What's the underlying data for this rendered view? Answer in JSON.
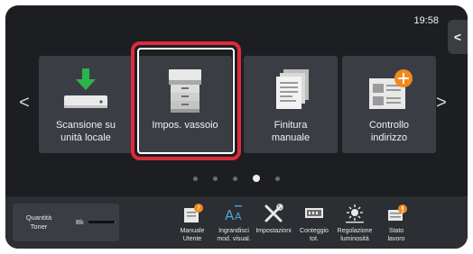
{
  "status": {
    "time": "19:58"
  },
  "side_tab_glyph": "<",
  "nav": {
    "prev_glyph": "<",
    "next_glyph": ">"
  },
  "tiles": [
    {
      "label_l1": "Scansione su",
      "label_l2": "unità locale",
      "icon": "scan-to-local-drive-icon"
    },
    {
      "label_l1": "Impos. vassoio",
      "label_l2": "",
      "icon": "tray-settings-printer-icon",
      "selected": true
    },
    {
      "label_l1": "Finitura",
      "label_l2": "manuale",
      "icon": "manual-finishing-icon"
    },
    {
      "label_l1": "Controllo",
      "label_l2": "indirizzo",
      "icon": "address-check-icon"
    }
  ],
  "pagination": {
    "total": 5,
    "active_index": 3
  },
  "toner": {
    "label_l1": "Quantità",
    "label_l2": "Toner",
    "color": "Bk",
    "level": 0.95
  },
  "bottom_items": [
    {
      "label_l1": "Manuale",
      "label_l2": "Utente",
      "icon": "user-manual-icon"
    },
    {
      "label_l1": "Ingrandisci",
      "label_l2": "mod. visual.",
      "icon": "enlarge-display-icon"
    },
    {
      "label_l1": "Impostazioni",
      "label_l2": "",
      "icon": "settings-tools-icon"
    },
    {
      "label_l1": "Conteggio",
      "label_l2": "tot.",
      "icon": "total-count-icon"
    },
    {
      "label_l1": "Regolazione",
      "label_l2": "luminosità",
      "icon": "brightness-icon"
    },
    {
      "label_l1": "Stato",
      "label_l2": "lavoro",
      "icon": "job-status-icon"
    }
  ],
  "colors": {
    "screen_bg": "#1c1e21",
    "tile_bg": "#3a3e44",
    "selection": "#e02a3c",
    "accent_green": "#2db34a",
    "accent_orange": "#f08a1c"
  }
}
